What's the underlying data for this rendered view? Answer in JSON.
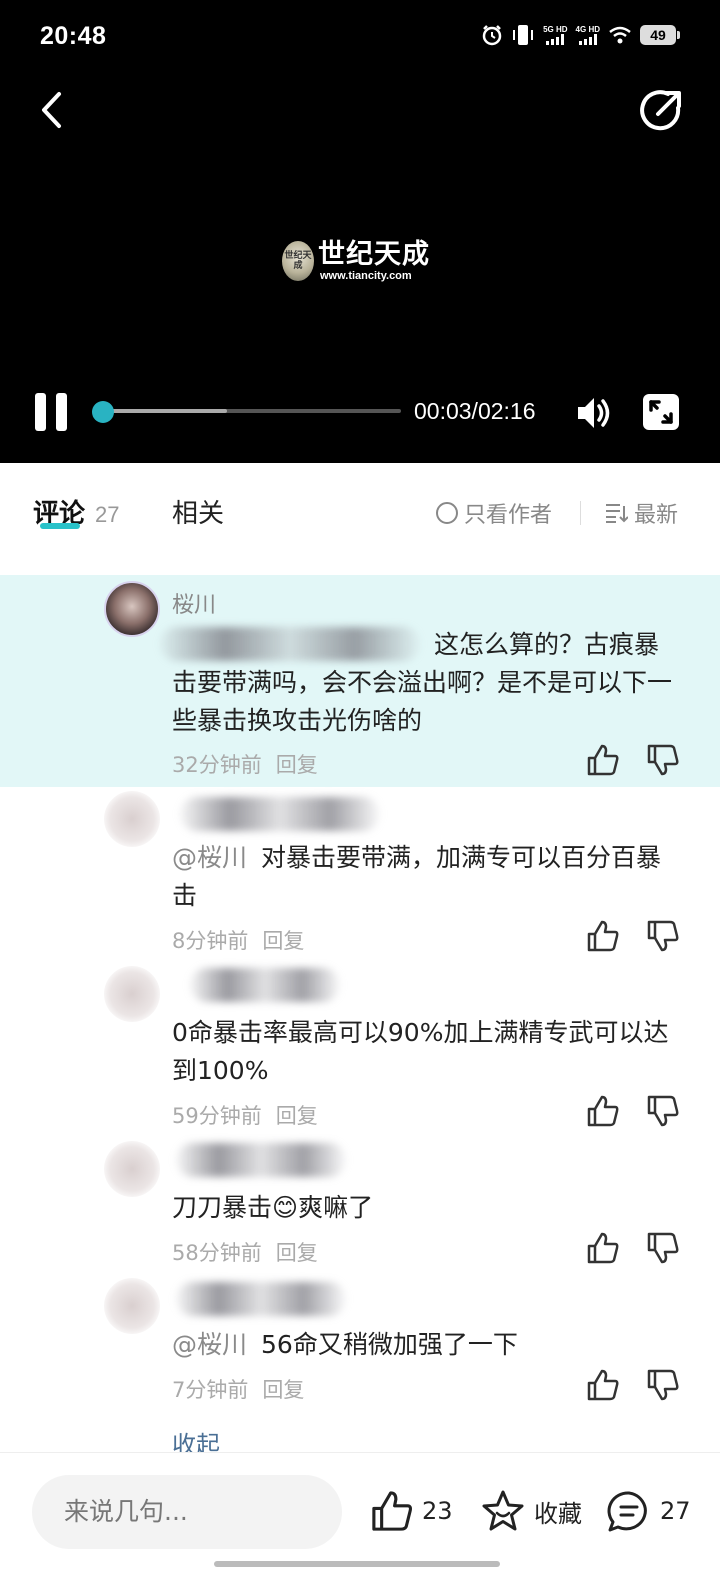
{
  "status_bar": {
    "time": "20:48",
    "net1_label": "5G HD",
    "net2_label": "4G HD",
    "battery": "49"
  },
  "video": {
    "logo_badge": "世纪天成",
    "logo_text": "世纪天成",
    "logo_url": "www.tiancity.com",
    "time_readout": "00:03/02:16",
    "progress_fraction": 0.023,
    "buffered_fraction": 0.43,
    "accent_color": "#29b3c2"
  },
  "tabs": {
    "comments_label": "评论",
    "comments_count": "27",
    "related_label": "相关",
    "author_only_label": "只看作者",
    "sort_label": "最新"
  },
  "comments": [
    {
      "username": "桜川",
      "mention": "",
      "text": "这怎么算的？古痕暴击要带满吗，会不会溢出啊？是不是可以下一些暴击换攻击光伤啥的",
      "time": "32分钟前",
      "reply": "回复"
    },
    {
      "username": "",
      "mention": "@桜川",
      "text": "对暴击要带满，加满专可以百分百暴击",
      "time": "8分钟前",
      "reply": "回复"
    },
    {
      "username": "",
      "mention": "",
      "text": "0命暴击率最高可以90%加上满精专武可以达到100%",
      "time": "59分钟前",
      "reply": "回复"
    },
    {
      "username": "",
      "mention": "",
      "text_before_emoji": "刀刀暴击",
      "emoji": "😊",
      "text_after_emoji": "爽嘛了",
      "time": "58分钟前",
      "reply": "回复"
    },
    {
      "username": "",
      "mention": "@桜川",
      "text": "56命又稍微加强了一下",
      "time": "7分钟前",
      "reply": "回复"
    }
  ],
  "collapse_label": "收起",
  "bottom_bar": {
    "input_placeholder": "来说几句...",
    "like_count": "23",
    "favorite_label": "收藏",
    "comment_count": "27"
  }
}
